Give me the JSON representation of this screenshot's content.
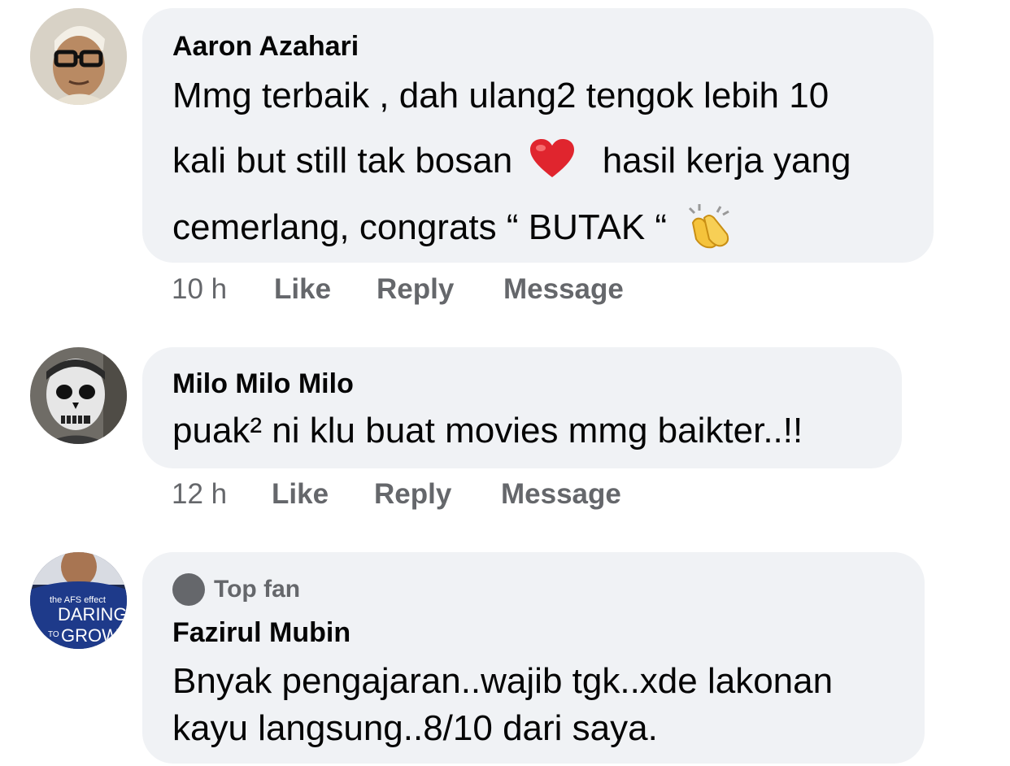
{
  "comments": [
    {
      "author": "Aaron Azahari",
      "lines": [
        "Mmg terbaik , dah ulang2 tengok lebih 10",
        "kali but still tak bosan",
        "hasil kerja yang",
        "cemerlang, congrats “ BUTAK “"
      ],
      "time": "10 h",
      "like": "Like",
      "reply": "Reply",
      "message": "Message"
    },
    {
      "author": "Milo Milo Milo",
      "lines": [
        "puak² ni klu buat movies mmg baikter..!!"
      ],
      "time": "12 h",
      "like": "Like",
      "reply": "Reply",
      "message": "Message"
    },
    {
      "badge": "Top fan",
      "author": "Fazirul Mubin",
      "lines": [
        "Bnyak pengajaran..wajib tgk..xde lakonan",
        "kayu langsung..8/10 dari saya."
      ],
      "avatar_shirt_text": [
        "the AFS effect",
        "DARING",
        "TO",
        "GROW"
      ]
    }
  ],
  "icons": [
    "heart-emoji-icon",
    "clapping-hands-emoji-icon",
    "top-fan-badge-icon"
  ],
  "colors": {
    "bubble": "#f0f2f5",
    "secondary_text": "#65676b",
    "primary_text": "#050505",
    "heart": "#e0252e",
    "clap": "#f5c33b"
  }
}
